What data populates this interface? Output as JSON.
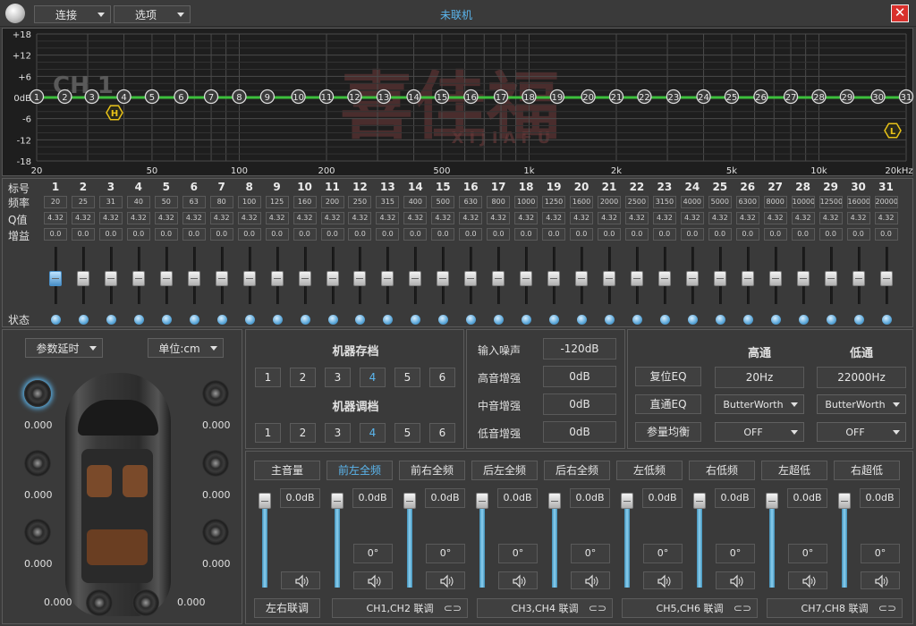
{
  "titlebar": {
    "title": "未联机",
    "connect_menu": "连接",
    "options_menu": "选项"
  },
  "graph": {
    "y_labels": [
      "+18",
      "+12",
      "+6",
      "0dB",
      "-6",
      "-12",
      "-18"
    ],
    "x_labels": [
      "20",
      "50",
      "100",
      "200",
      "500",
      "1k",
      "2k",
      "5k",
      "10k",
      "20kHz"
    ],
    "channel": "CH 1",
    "markers": [
      "1",
      "2",
      "3",
      "4",
      "5",
      "6",
      "7",
      "8",
      "9",
      "10",
      "11",
      "12",
      "13",
      "14",
      "15",
      "16",
      "17",
      "18",
      "19",
      "20",
      "21",
      "22",
      "23",
      "24",
      "25",
      "26",
      "27",
      "28",
      "29",
      "30",
      "31"
    ],
    "hpf_label": "H",
    "lpf_label": "L",
    "watermark_brand": "喜佳福",
    "watermark_latin": "XIJIAFU"
  },
  "eq": {
    "row_labels": {
      "index": "标号",
      "freq": "频率",
      "q": "Q值",
      "gain": "增益",
      "state": "状态"
    },
    "numbers": [
      "1",
      "2",
      "3",
      "4",
      "5",
      "6",
      "7",
      "8",
      "9",
      "10",
      "11",
      "12",
      "13",
      "14",
      "15",
      "16",
      "17",
      "18",
      "19",
      "20",
      "21",
      "22",
      "23",
      "24",
      "25",
      "26",
      "27",
      "28",
      "29",
      "30",
      "31"
    ],
    "freqs": [
      "20",
      "25",
      "31",
      "40",
      "50",
      "63",
      "80",
      "100",
      "125",
      "160",
      "200",
      "250",
      "315",
      "400",
      "500",
      "630",
      "800",
      "1000",
      "1250",
      "1600",
      "2000",
      "2500",
      "3150",
      "4000",
      "5000",
      "6300",
      "8000",
      "10000",
      "12500",
      "16000",
      "20000"
    ],
    "q": "4.32",
    "gain": "0.0"
  },
  "delay": {
    "mode": "参数延时",
    "unit": "单位:cm",
    "values": {
      "fl": "0.000",
      "fr": "0.000",
      "ml": "0.000",
      "mr": "0.000",
      "rl": "0.000",
      "rr": "0.000",
      "sl": "0.000",
      "sr": "0.000"
    }
  },
  "presets": {
    "save_title": "机器存档",
    "load_title": "机器调档",
    "save_buttons": [
      "1",
      "2",
      "3",
      "4",
      "5",
      "6"
    ],
    "load_buttons": [
      "1",
      "2",
      "3",
      "4",
      "5",
      "6"
    ]
  },
  "input": {
    "noise_label": "输入噪声",
    "noise_value": "-120dB",
    "treble_label": "高音增强",
    "treble_value": "0dB",
    "mid_label": "中音增强",
    "mid_value": "0dB",
    "bass_label": "低音增强",
    "bass_value": "0dB"
  },
  "xover": {
    "hp_title": "高通",
    "lp_title": "低通",
    "reset_eq": "复位EQ",
    "direct_eq": "直通EQ",
    "param_eq": "参量均衡",
    "hp_freq": "20Hz",
    "lp_freq": "22000Hz",
    "hp_type": "ButterWorth",
    "lp_type": "ButterWorth",
    "hp_slope": "OFF",
    "lp_slope": "OFF"
  },
  "mixer": {
    "channels": [
      {
        "label": "主音量",
        "value": "0.0dB"
      },
      {
        "label": "前左全频",
        "value": "0.0dB",
        "phase": "0°"
      },
      {
        "label": "前右全频",
        "value": "0.0dB",
        "phase": "0°"
      },
      {
        "label": "后左全频",
        "value": "0.0dB",
        "phase": "0°"
      },
      {
        "label": "后右全频",
        "value": "0.0dB",
        "phase": "0°"
      },
      {
        "label": "左低频",
        "value": "0.0dB",
        "phase": "0°"
      },
      {
        "label": "右低频",
        "value": "0.0dB",
        "phase": "0°"
      },
      {
        "label": "左超低",
        "value": "0.0dB",
        "phase": "0°"
      },
      {
        "label": "右超低",
        "value": "0.0dB",
        "phase": "0°"
      }
    ],
    "link_lr": "左右联调",
    "links": [
      "CH1,CH2 联调",
      "CH3,CH4 联调",
      "CH5,CH6 联调",
      "CH7,CH8 联调"
    ]
  },
  "colors": {
    "accent": "#4aa3df",
    "selected_text": "#5bb6ee",
    "graph_line": "#3cbf3c",
    "close": "#d9302c",
    "marker_gold": "#e8c218"
  }
}
